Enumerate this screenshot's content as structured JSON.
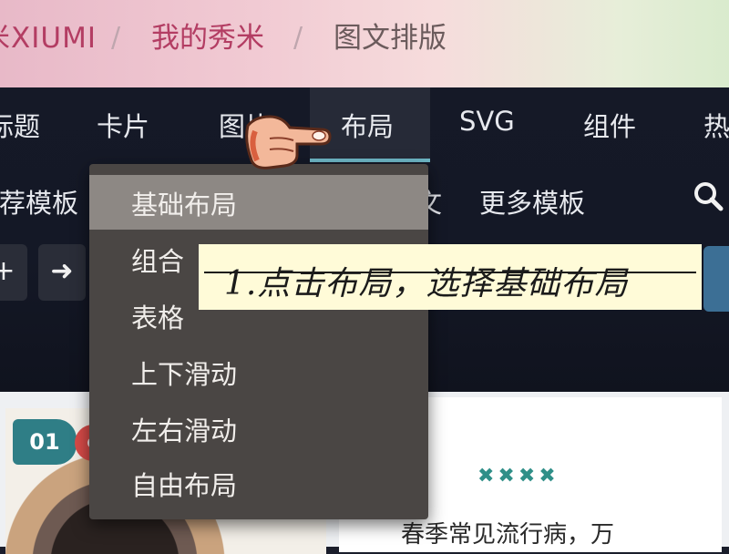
{
  "breadcrumb": {
    "brand": "米XIUMI",
    "separator": "/",
    "my_xiumi": "我的秀米",
    "current": "图文排版"
  },
  "nav": {
    "tabs": [
      "标题",
      "卡片",
      "图片",
      "布局",
      "SVG",
      "组件",
      "热"
    ],
    "active_tab": "布局",
    "row2": [
      "推荐模板",
      "更多模板"
    ],
    "row2_partial": "文"
  },
  "toolbar": {
    "add_glyph": "+",
    "forward_glyph": "➜"
  },
  "dropdown": {
    "items": [
      "基础布局",
      "组合",
      "表格",
      "上下滑动",
      "左右滑动",
      "自由布局"
    ],
    "highlighted": "基础布局"
  },
  "annotation": {
    "text": "1.点击布局，选择基础布局"
  },
  "content": {
    "badge": "01",
    "stars": "✖✖✖✖",
    "paragraph": "春季常见流行病，万"
  },
  "colors": {
    "brand": "#b33d63",
    "nav_bg": "#151927",
    "active_underline": "#6fb9c8",
    "dropdown_bg": "#4a4644",
    "dropdown_highlight": "#8d8884",
    "badge": "#2f7e86",
    "note_bg": "#fffbd8"
  }
}
